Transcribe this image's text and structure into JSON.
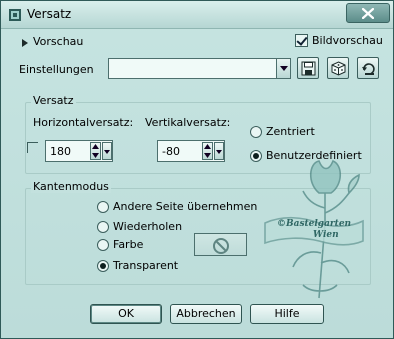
{
  "window": {
    "title": "Versatz"
  },
  "top": {
    "preview_toggle_label": "Vorschau",
    "bildvorschau_label": "Bildvorschau",
    "bildvorschau_checked": true
  },
  "settings": {
    "label": "Einstellungen",
    "value": ""
  },
  "versatz": {
    "title": "Versatz",
    "horizontal_label": "Horizontalversatz:",
    "horizontal_value": "180",
    "vertical_label": "Vertikalversatz:",
    "vertical_value": "-80",
    "link_checked": false,
    "options": [
      {
        "label": "Zentriert",
        "selected": false
      },
      {
        "label": "Benutzerdefiniert",
        "selected": true
      }
    ]
  },
  "kantenmodus": {
    "title": "Kantenmodus",
    "options": [
      {
        "label": "Andere Seite übernehmen",
        "selected": false
      },
      {
        "label": "Wiederholen",
        "selected": false
      },
      {
        "label": "Farbe",
        "selected": false
      },
      {
        "label": "Transparent",
        "selected": true
      }
    ]
  },
  "watermark": {
    "line1": "©Bastelgarten",
    "line2": "Wien"
  },
  "buttons": {
    "ok": "OK",
    "cancel": "Abbrechen",
    "help": "Hilfe"
  },
  "colors": {
    "dialog_bg": "#c2e1de",
    "accent": "#4f8784"
  }
}
